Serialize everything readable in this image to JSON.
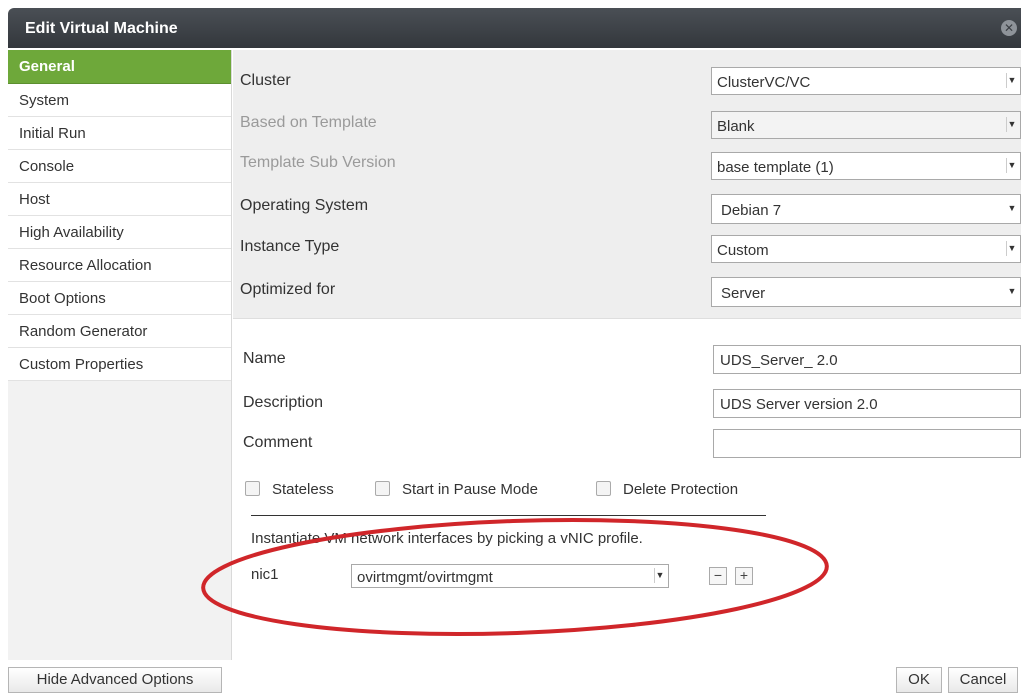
{
  "dialog": {
    "title": "Edit Virtual Machine"
  },
  "sidebar": {
    "items": [
      {
        "label": "General"
      },
      {
        "label": "System"
      },
      {
        "label": "Initial Run"
      },
      {
        "label": "Console"
      },
      {
        "label": "Host"
      },
      {
        "label": "High Availability"
      },
      {
        "label": "Resource Allocation"
      },
      {
        "label": "Boot Options"
      },
      {
        "label": "Random Generator"
      },
      {
        "label": "Custom Properties"
      }
    ]
  },
  "general": {
    "cluster": {
      "label": "Cluster",
      "value": "ClusterVC/VC"
    },
    "template": {
      "label": "Based on Template",
      "value": "Blank"
    },
    "sub_version": {
      "label": "Template Sub Version",
      "value": "base template (1)"
    },
    "os": {
      "label": "Operating System",
      "value": "Debian 7"
    },
    "instance_type": {
      "label": "Instance Type",
      "value": "Custom"
    },
    "optimized": {
      "label": "Optimized for",
      "value": "Server"
    },
    "name": {
      "label": "Name",
      "value": "UDS_Server_ 2.0"
    },
    "description": {
      "label": "Description",
      "value": "UDS Server version 2.0"
    },
    "comment": {
      "label": "Comment",
      "value": ""
    },
    "checkboxes": {
      "stateless": "Stateless",
      "pause": "Start in Pause Mode",
      "delete_protection": "Delete Protection"
    },
    "network": {
      "instruction": "Instantiate VM network interfaces by picking a vNIC profile.",
      "nic_label": "nic1",
      "nic_value": "ovirtmgmt/ovirtmgmt",
      "remove": "−",
      "add": "+"
    }
  },
  "footer": {
    "hide_advanced": "Hide Advanced Options",
    "ok": "OK",
    "cancel": "Cancel"
  },
  "colors": {
    "titlebar": "#3b3f44",
    "active_tab": "#6ea83a",
    "annotation": "#d0262a"
  }
}
